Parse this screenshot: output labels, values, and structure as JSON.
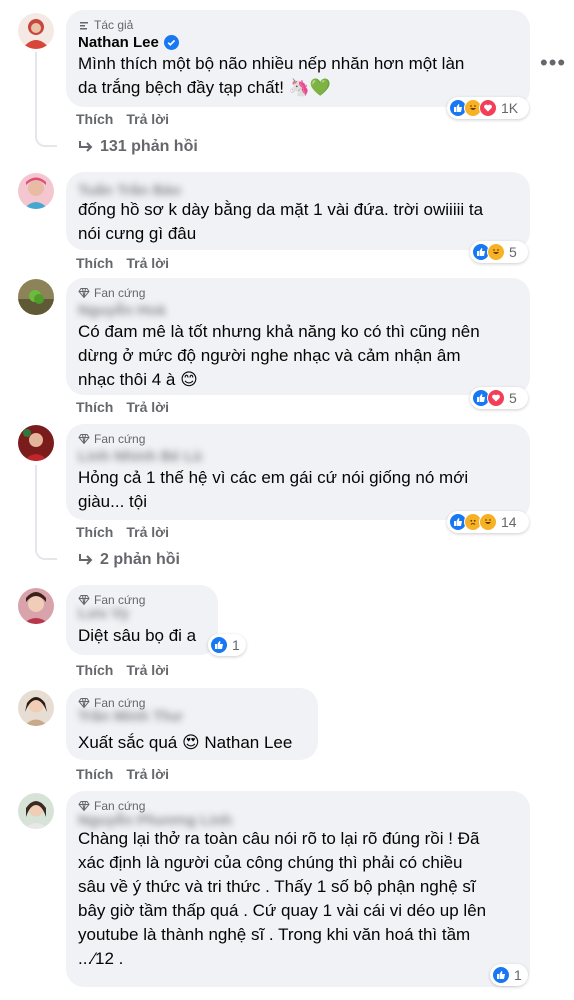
{
  "comments": [
    {
      "badge": "Tác giả",
      "author": "Nathan Lee",
      "lines": [
        "Mình thích một bộ não nhiều nếp nhăn hơn một làn",
        "da trắng bệch đầy tạp chất! 🦄💚"
      ],
      "like": "Thích",
      "reply": "Trả lời",
      "reaction_count": "1K",
      "replies_label": "131 phản hồi"
    },
    {
      "badge": "",
      "author": "Tuấn Trần Bảo",
      "lines": [
        "đống hồ sơ k dày bằng da mặt 1 vài đứa. trời owiiiii ta",
        "nói cưng gì đâu"
      ],
      "like": "Thích",
      "reply": "Trả lời",
      "reaction_count": "5"
    },
    {
      "badge": "Fan cứng",
      "author": "Nguyễn Hoà",
      "lines": [
        "Có đam mê là tốt nhưng khả năng ko có thì cũng nên",
        "dừng ở mức độ người nghe nhạc và cảm nhận âm",
        "nhạc thôi 4 à 😊"
      ],
      "like": "Thích",
      "reply": "Trả lời",
      "reaction_count": "5"
    },
    {
      "badge": "Fan cứng",
      "author": "Linh Nhinh Bé Lù",
      "lines": [
        "Hỏng cả 1 thế hệ vì các em gái cứ nói giống nó mới",
        "giàu... tội"
      ],
      "like": "Thích",
      "reply": "Trả lời",
      "reaction_count": "14",
      "replies_label": "2 phản hồi"
    },
    {
      "badge": "Fan cứng",
      "author": "Lưu Vy",
      "lines": [
        "Diệt sâu bọ đi a"
      ],
      "like": "Thích",
      "reply": "Trả lời",
      "reaction_count": "1"
    },
    {
      "badge": "Fan cứng",
      "author": "Trần Minh Thư",
      "lines": [
        "Xuất sắc quá 😍 Nathan Lee"
      ],
      "like": "Thích",
      "reply": "Trả lời"
    },
    {
      "badge": "Fan cứng",
      "author": "Nguyễn Phương Linh",
      "lines": [
        "Chàng lại thở ra toàn câu nói rõ to lại rõ đúng rồi ! Đã",
        "xác định là người của công chúng thì phải có chiều",
        "sâu về ý thức và tri thức . Thấy 1 số bộ phận nghệ sĩ",
        "bây giờ tầm thấp quá . Cứ quay 1 vài cái vi déo up lên",
        "youtube là thành nghệ sĩ . Trong khi văn hoá thì tầm",
        "...⁄12 ."
      ],
      "reaction_count": "1"
    }
  ],
  "colors": {
    "like_blue": "#1877f2",
    "love_red": "#f33e58",
    "haha_yellow": "#f7b125",
    "bubble_bg": "#f0f2f5",
    "secondary_text": "#65676b"
  }
}
